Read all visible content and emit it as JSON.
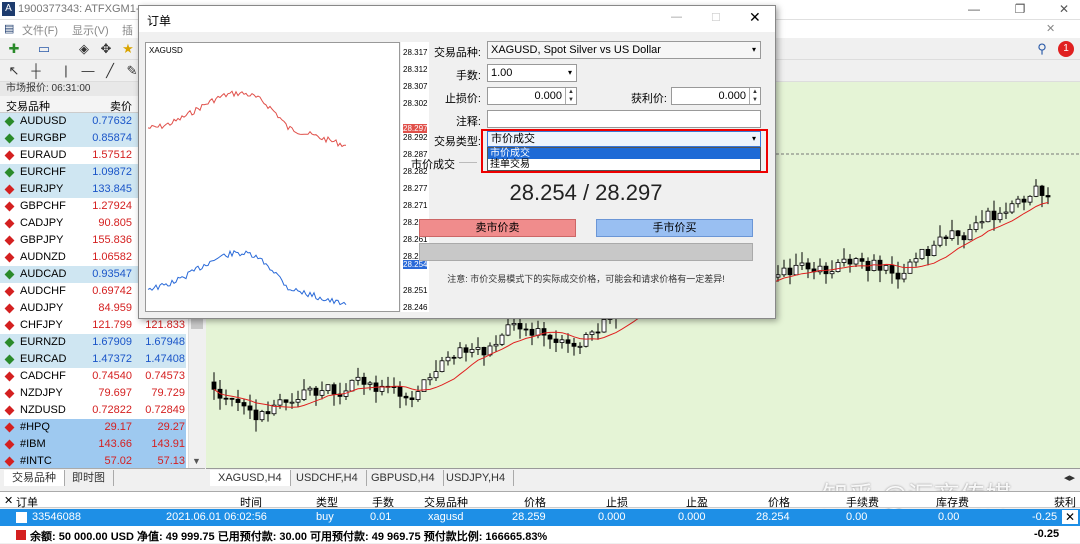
{
  "window": {
    "title": "1900377343: ATFXGM1-",
    "min": "—",
    "max": "❐",
    "close": "✕"
  },
  "menu": {
    "items": [
      "文件(F)",
      "显示(V)",
      "插"
    ]
  },
  "market_watch": {
    "header": "市场报价: 06:31:00",
    "col_symbol": "交易品种",
    "col_bid": "卖价",
    "rows": [
      {
        "symbol": "AUDUSD",
        "bid": "0.77632",
        "ask": "",
        "color": "#1a55c8",
        "bg": "#cfe6f2",
        "dir": "up"
      },
      {
        "symbol": "EURGBP",
        "bid": "0.85874",
        "ask": "",
        "color": "#1a55c8",
        "bg": "#cfe6f2",
        "dir": "up"
      },
      {
        "symbol": "EURAUD",
        "bid": "1.57512",
        "ask": "",
        "color": "#d42020",
        "bg": "#ffffff",
        "dir": "down"
      },
      {
        "symbol": "EURCHF",
        "bid": "1.09872",
        "ask": "",
        "color": "#1a55c8",
        "bg": "#cfe6f2",
        "dir": "up"
      },
      {
        "symbol": "EURJPY",
        "bid": "133.845",
        "ask": "",
        "color": "#1a55c8",
        "bg": "#cfe6f2",
        "dir": "down"
      },
      {
        "symbol": "GBPCHF",
        "bid": "1.27924",
        "ask": "",
        "color": "#d42020",
        "bg": "#ffffff",
        "dir": "down"
      },
      {
        "symbol": "CADJPY",
        "bid": "90.805",
        "ask": "",
        "color": "#d42020",
        "bg": "#ffffff",
        "dir": "down"
      },
      {
        "symbol": "GBPJPY",
        "bid": "155.836",
        "ask": "",
        "color": "#d42020",
        "bg": "#ffffff",
        "dir": "down"
      },
      {
        "symbol": "AUDNZD",
        "bid": "1.06582",
        "ask": "",
        "color": "#d42020",
        "bg": "#ffffff",
        "dir": "down"
      },
      {
        "symbol": "AUDCAD",
        "bid": "0.93547",
        "ask": "",
        "color": "#1a55c8",
        "bg": "#cfe6f2",
        "dir": "up"
      },
      {
        "symbol": "AUDCHF",
        "bid": "0.69742",
        "ask": "",
        "color": "#d42020",
        "bg": "#ffffff",
        "dir": "down"
      },
      {
        "symbol": "AUDJPY",
        "bid": "84.959",
        "ask": "",
        "color": "#d42020",
        "bg": "#ffffff",
        "dir": "down"
      },
      {
        "symbol": "CHFJPY",
        "bid": "121.799",
        "ask": "121.833",
        "color": "#d42020",
        "bg": "#ffffff",
        "dir": "down"
      },
      {
        "symbol": "EURNZD",
        "bid": "1.67909",
        "ask": "1.67948",
        "color": "#1a55c8",
        "bg": "#cfe6f2",
        "dir": "up"
      },
      {
        "symbol": "EURCAD",
        "bid": "1.47372",
        "ask": "1.47408",
        "color": "#1a55c8",
        "bg": "#cfe6f2",
        "dir": "up"
      },
      {
        "symbol": "CADCHF",
        "bid": "0.74540",
        "ask": "0.74573",
        "color": "#d42020",
        "bg": "#ffffff",
        "dir": "down"
      },
      {
        "symbol": "NZDJPY",
        "bid": "79.697",
        "ask": "79.729",
        "color": "#d42020",
        "bg": "#ffffff",
        "dir": "down"
      },
      {
        "symbol": "NZDUSD",
        "bid": "0.72822",
        "ask": "0.72849",
        "color": "#d42020",
        "bg": "#ffffff",
        "dir": "down"
      },
      {
        "symbol": "#HPQ",
        "bid": "29.17",
        "ask": "29.27",
        "color": "#d42020",
        "bg": "#9ec9f0",
        "dir": "down"
      },
      {
        "symbol": "#IBM",
        "bid": "143.66",
        "ask": "143.91",
        "color": "#d42020",
        "bg": "#9ec9f0",
        "dir": "down"
      },
      {
        "symbol": "#INTC",
        "bid": "57.02",
        "ask": "57.13",
        "color": "#d42020",
        "bg": "#9ec9f0",
        "dir": "down"
      }
    ],
    "tabs": [
      "交易品种",
      "即时图"
    ]
  },
  "chart_tabs": [
    "XAGUSD,H4",
    "USDCHF,H4",
    "GBPUSD,H4",
    "USDJPY,H4"
  ],
  "dialog": {
    "title": "订单",
    "mini_chart_symbol": "XAGUSD",
    "scale": [
      "28.317",
      "28.312",
      "28.307",
      "28.302",
      "28.297",
      "28.292",
      "28.287",
      "28.282",
      "28.277",
      "28.271",
      "28.266",
      "28.261",
      "28.256",
      "28.254",
      "28.251",
      "28.246"
    ],
    "symbol_label": "交易品种:",
    "symbol_value": "XAGUSD, Spot Silver vs US Dollar",
    "volume_label": "手数:",
    "volume_value": "1.00",
    "sl_label": "止损价:",
    "sl_value": "0.000",
    "tp_label": "获利价:",
    "tp_value": "0.000",
    "comment_label": "注释:",
    "type_label": "交易类型:",
    "type_value": "市价成交",
    "type_options": [
      "市价成交",
      "挂单交易"
    ],
    "section_label": "市价成交",
    "price_bid": "28.254",
    "price_sep": " / ",
    "price_ask": "28.297",
    "sell_label": "卖市价卖",
    "buy_label": "手市价买",
    "note": "注意: 市价交易模式下的实际成交价格，可能会和请求价格有一定差异!"
  },
  "terminal": {
    "headers": [
      "订单",
      "时间",
      "类型",
      "手数",
      "交易品种",
      "价格",
      "止损",
      "止盈",
      "价格",
      "手续费",
      "库存费",
      "获利"
    ],
    "row": [
      "33546088",
      "2021.06.01 06:02:56",
      "buy",
      "0.01",
      "xagusd",
      "28.259",
      "0.000",
      "0.000",
      "28.254",
      "0.00",
      "0.00",
      "-0.25"
    ],
    "footer": "余额: 50 000.00 USD  净值: 49 999.75  已用预付款: 30.00  可用预付款: 49 969.75  预付款比例: 166665.83%",
    "footer_value": "-0.25"
  },
  "watermark": "知乎 @汇商传媒",
  "colors": {
    "chart_bg": "#e5f4d6",
    "bull": "#ffffff",
    "bear": "#000000",
    "ma": "#e02020",
    "mini_bid": "#e0504a",
    "mini_ask": "#2a6ad8"
  }
}
